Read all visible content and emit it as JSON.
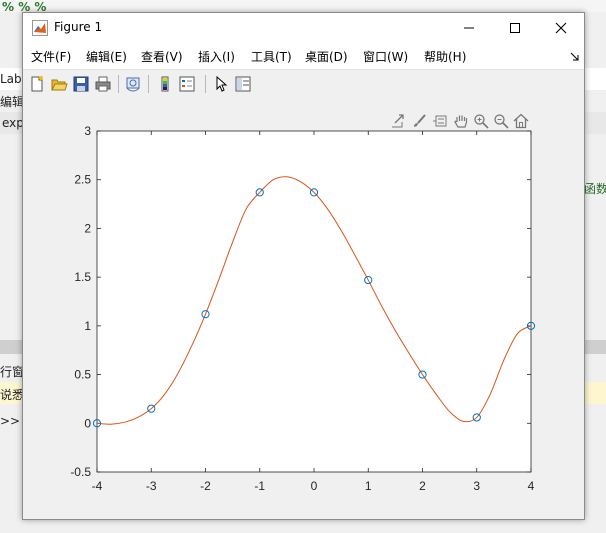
{
  "background": {
    "row_top": "%  %  %",
    "lab_label": "Lab",
    "edit_label": "编辑",
    "exp_label": "exp",
    "func_label": "函数",
    "row_window": "行窗",
    "row_desc": "说悉",
    "prompt": ">>"
  },
  "window": {
    "title": "Figure 1",
    "minimize_icon": "minimize-icon",
    "maximize_icon": "maximize-icon",
    "close_icon": "close-icon"
  },
  "menu": {
    "items": [
      {
        "label": "文件(F)"
      },
      {
        "label": "编辑(E)"
      },
      {
        "label": "查看(V)"
      },
      {
        "label": "插入(I)"
      },
      {
        "label": "工具(T)"
      },
      {
        "label": "桌面(D)"
      },
      {
        "label": "窗口(W)"
      },
      {
        "label": "帮助(H)"
      }
    ]
  },
  "toolbar": {
    "icons": [
      "new-figure-icon",
      "open-file-icon",
      "save-icon",
      "print-icon",
      "link-plot-icon",
      "colorbar-icon",
      "legend-icon",
      "edit-plot-arrow-icon",
      "property-inspector-icon"
    ]
  },
  "axes_toolbar": {
    "icons": [
      "export-icon",
      "brush-icon",
      "data-tips-icon",
      "pan-hand-icon",
      "zoom-in-icon",
      "zoom-out-icon",
      "home-icon"
    ]
  },
  "chart_data": {
    "type": "line",
    "title": "",
    "xlabel": "",
    "ylabel": "",
    "xlim": [
      -4,
      4
    ],
    "ylim": [
      -0.5,
      3
    ],
    "xticks": [
      -4,
      -3,
      -2,
      -1,
      0,
      1,
      2,
      3,
      4
    ],
    "yticks": [
      -0.5,
      0,
      0.5,
      1,
      1.5,
      2,
      2.5,
      3
    ],
    "grid": false,
    "series": [
      {
        "kind": "markers",
        "marker": "circle",
        "color": "#0072bd",
        "x": [
          -4,
          -3,
          -2,
          -1,
          0,
          1,
          2,
          3,
          4
        ],
        "y": [
          0,
          0.15,
          1.12,
          2.37,
          2.37,
          1.47,
          0.5,
          0.06,
          1.0
        ]
      },
      {
        "kind": "curve",
        "color": "#d95319",
        "x": [
          -4,
          -3.75,
          -3.5,
          -3.25,
          -3,
          -2.75,
          -2.5,
          -2.25,
          -2,
          -1.75,
          -1.5,
          -1.25,
          -1,
          -0.75,
          -0.5,
          -0.25,
          0,
          0.25,
          0.5,
          0.75,
          1,
          1.25,
          1.5,
          1.75,
          2,
          2.25,
          2.5,
          2.75,
          3,
          3.25,
          3.5,
          3.75,
          4
        ],
        "y": [
          0,
          -0.01,
          0.01,
          0.06,
          0.15,
          0.3,
          0.52,
          0.8,
          1.12,
          1.48,
          1.86,
          2.2,
          2.37,
          2.5,
          2.53,
          2.48,
          2.37,
          2.2,
          1.98,
          1.73,
          1.47,
          1.2,
          0.95,
          0.72,
          0.5,
          0.3,
          0.12,
          0.02,
          0.06,
          0.3,
          0.65,
          0.92,
          1.0
        ]
      }
    ]
  }
}
